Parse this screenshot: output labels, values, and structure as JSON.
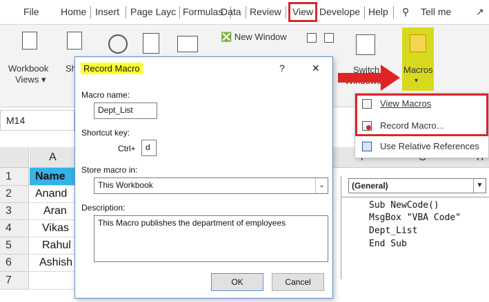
{
  "ribbon_tabs": [
    "File",
    "Home",
    "Insert",
    "Page Layc",
    "Formulas",
    "Data",
    "Review",
    "View",
    "Develope",
    "Help"
  ],
  "tell_me": "Tell me",
  "ribbon": {
    "workbook_views": "Workbook",
    "workbook_views2": "Views ▾",
    "show_partial": "Sh",
    "new_window": "New Window",
    "switch_windows": "Switch",
    "switch_windows2": "Windows ▾",
    "macros": "Macros",
    "macros_arrow": "▾"
  },
  "name_box": "M14",
  "column_headers": {
    "a": "A",
    "f": "F",
    "g": "G",
    "h": "H"
  },
  "rows": [
    {
      "num": "1",
      "a": "Name"
    },
    {
      "num": "2",
      "a": "Anand"
    },
    {
      "num": "3",
      "a": "Aran"
    },
    {
      "num": "4",
      "a": "Vikas"
    },
    {
      "num": "5",
      "a": "Rahul"
    },
    {
      "num": "6",
      "a": "Ashish"
    },
    {
      "num": "7",
      "a": ""
    }
  ],
  "dialog": {
    "title": "Record Macro",
    "help": "?",
    "close": "✕",
    "macro_name_label": "Macro name:",
    "macro_name_value": "Dept_List",
    "shortcut_label": "Shortcut key:",
    "ctrl_label": "Ctrl+",
    "shortcut_value": "d",
    "store_label": "Store macro in:",
    "store_value": "This Workbook",
    "description_label": "Description:",
    "description_value": "This Macro publishes the department of employees",
    "ok": "OK",
    "cancel": "Cancel"
  },
  "macros_menu": [
    {
      "label": "View Macros",
      "icon": "view-macros-icon"
    },
    {
      "label": "Record Macro...",
      "icon": "record-macro-icon"
    },
    {
      "label": "Use Relative References",
      "icon": "relative-references-icon"
    }
  ],
  "vba": {
    "dropdown": "(General)",
    "lines": [
      "Sub NewCode()",
      "MsgBox \"VBA Code\"",
      "Dept_List",
      "End Sub"
    ]
  },
  "colors": {
    "highlight_red": "#d9262c",
    "header_blue": "#35b3e8",
    "title_yellow": "#ffff33"
  }
}
